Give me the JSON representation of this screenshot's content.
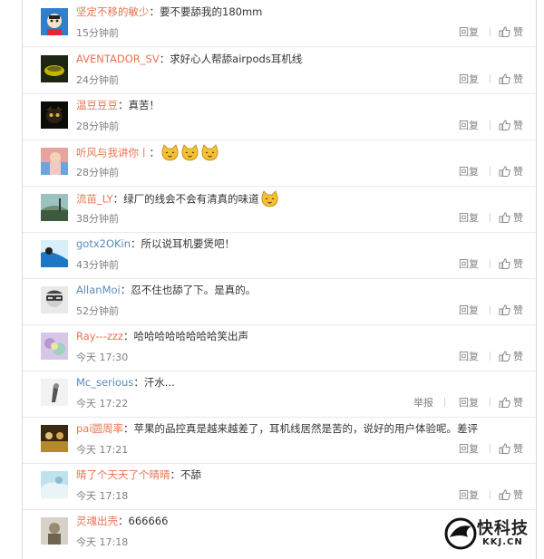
{
  "ops": {
    "reply": "回复",
    "like": "赞",
    "report": "举报"
  },
  "comments": [
    {
      "user": "坚定不移的敏少",
      "text": "要不要舔我的180mm",
      "time": "15分钟前"
    },
    {
      "user": "AVENTADOR_SV",
      "text": "求好心人帮舔airpods耳机线",
      "time": "24分钟前"
    },
    {
      "user": "温豆豆豆",
      "text": "真苦！",
      "time": "28分钟前"
    },
    {
      "user": "听风与我讲你丨",
      "text": "",
      "time": "28分钟前"
    },
    {
      "user": "流苗_LY",
      "text": "绿厂的线会不会有清真的味道",
      "time": "38分钟前"
    },
    {
      "user": "gotx2OKin",
      "text": "所以说耳机要煲吧！",
      "time": "43分钟前"
    },
    {
      "user": "AllanMoi",
      "text": "忍不住也舔了下。是真的。",
      "time": "52分钟前"
    },
    {
      "user": "Ray---zzz",
      "text": "哈哈哈哈哈哈哈哈笑出声",
      "time": "今天 17:30"
    },
    {
      "user": "Mc_serious",
      "text": "汗水...",
      "time": "今天 17:22"
    },
    {
      "user": "pai圆周率",
      "text": "苹果的品控真是越来越差了，耳机线居然是苦的，说好的用户体验呢。差评",
      "time": "今天 17:21"
    },
    {
      "user": "晴了个天天了个晴晴",
      "text": "不舔",
      "time": "今天 17:18"
    },
    {
      "user": "灵魂出壳",
      "text": "666666",
      "time": "今天 17:18"
    }
  ],
  "watermark": {
    "name": "快科技",
    "domain": "KKJ.CN"
  }
}
